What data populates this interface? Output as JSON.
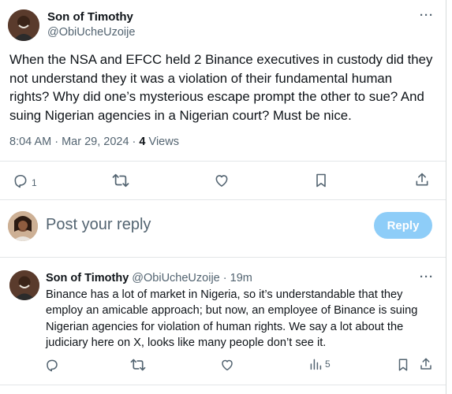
{
  "tweet": {
    "author_name": "Son of Timothy",
    "author_handle": "@ObiUcheUzoije",
    "text": "When the NSA and EFCC held 2 Binance executives in custody did they not understand they it was a violation of their fundamental human rights? Why did one’s mysterious escape prompt the other to sue? And suing Nigerian agencies in a Nigerian court? Must be nice.",
    "time": "8:04 AM · Mar 29, 2024 · ",
    "views_count": "4",
    "views_label": " Views",
    "more_icon": "more-dots-icon",
    "actions": {
      "reply_count": "1",
      "icons": [
        "reply-icon",
        "retweet-icon",
        "like-icon",
        "bookmark-icon",
        "share-icon"
      ]
    }
  },
  "composer": {
    "placeholder": "Post your reply",
    "button_label": "Reply",
    "button_color": "#8ecdf8"
  },
  "reply": {
    "author_name": "Son of Timothy",
    "author_handle": "@ObiUcheUzoije",
    "separator": " · ",
    "time": "19m",
    "text": "Binance has a lot of market in Nigeria, so it’s understandable that they employ an amicable approach; but now, an employee of Binance is suing Nigerian agencies for violation of human rights. We say a lot about the judiciary here on X, looks like many people don’t see it.",
    "views_count": "5"
  },
  "colors": {
    "text": "#0f1419",
    "secondary": "#536471",
    "divider": "#e3e6e8"
  }
}
